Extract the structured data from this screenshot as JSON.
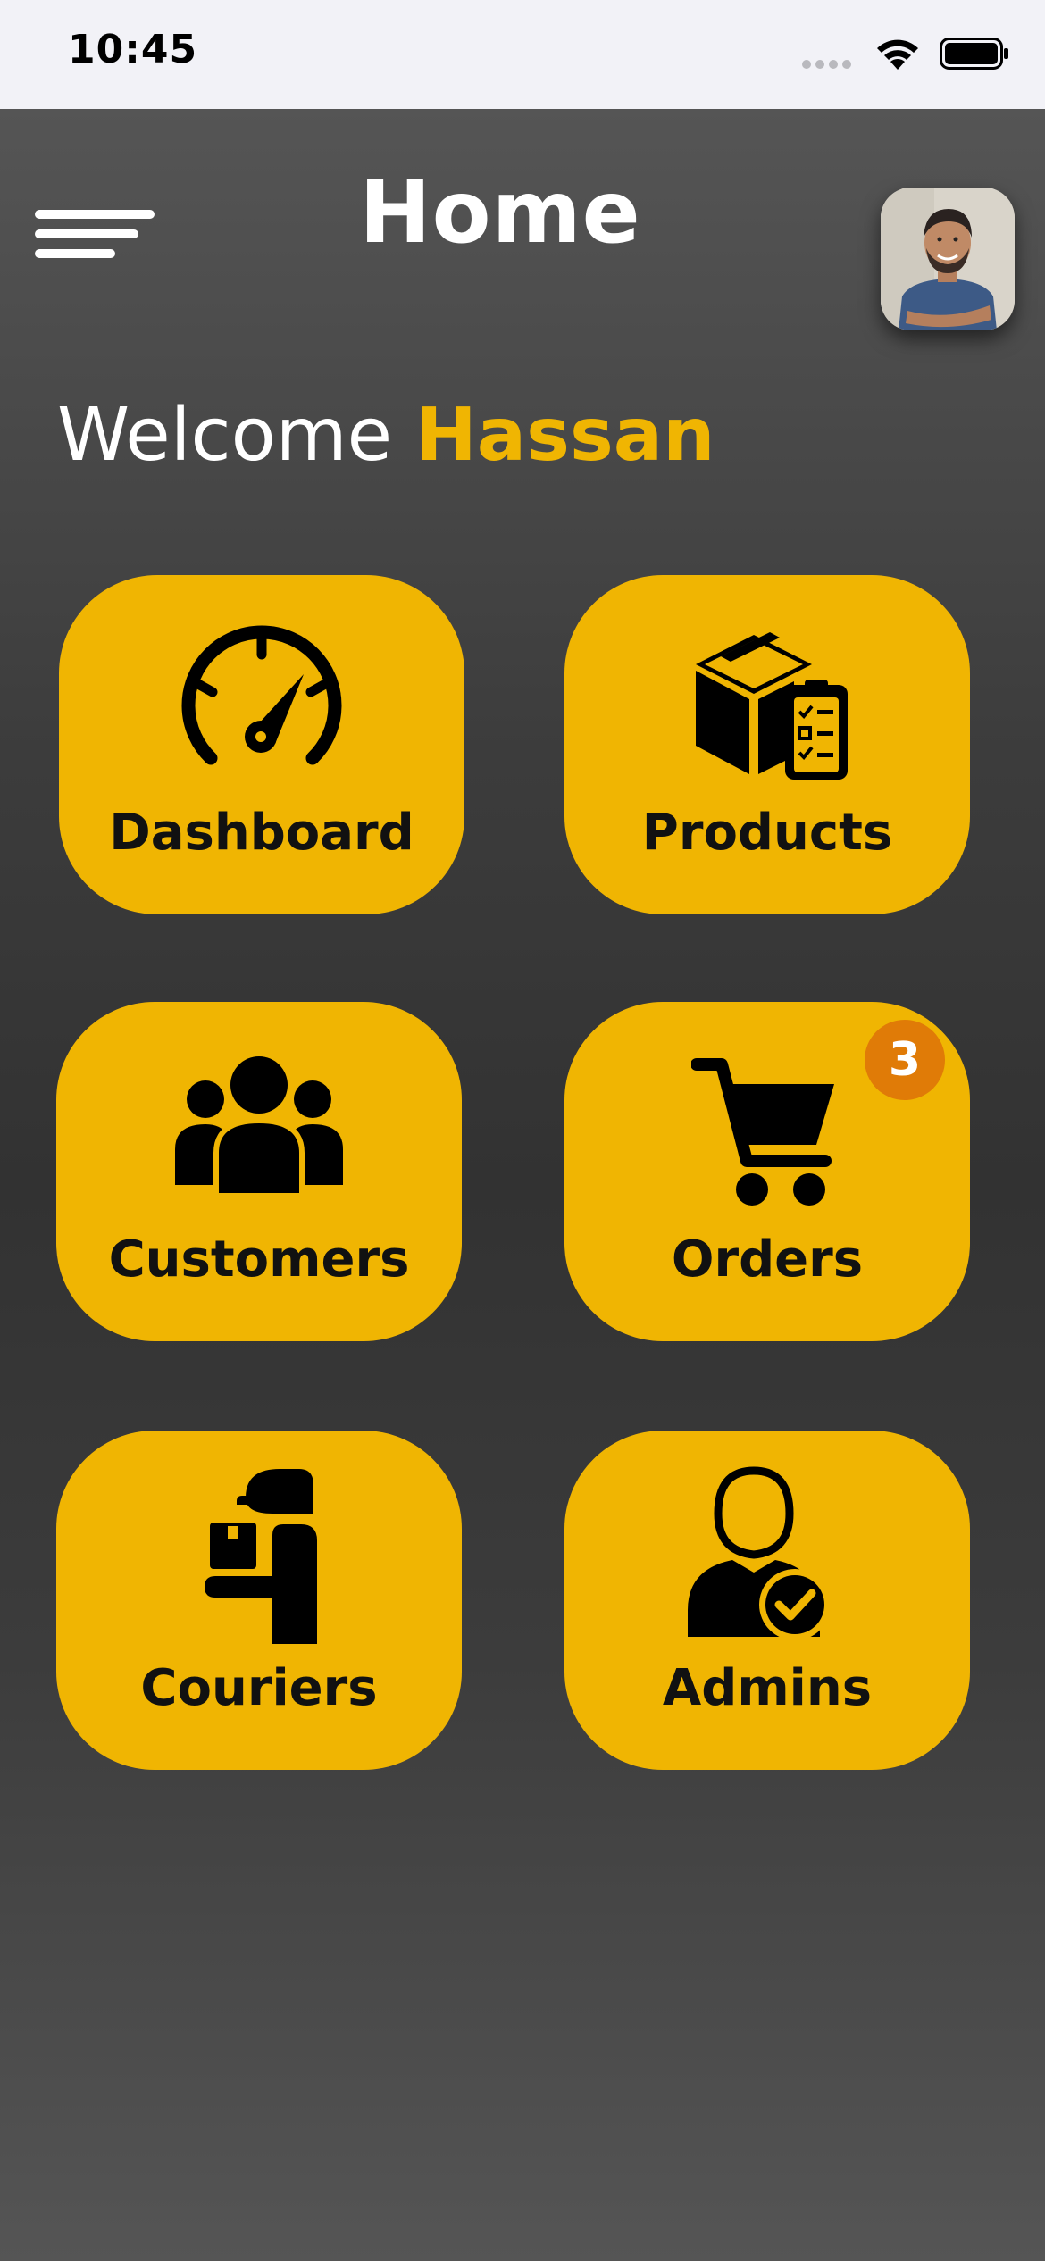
{
  "status_bar": {
    "time": "10:45",
    "icons": [
      "cellular-signal-icon",
      "wifi-icon",
      "battery-icon"
    ]
  },
  "header": {
    "title": "Home",
    "menu_icon": "hamburger-menu-icon",
    "avatar": "user-avatar"
  },
  "welcome": {
    "prefix": "Welcome",
    "name": "Hassan"
  },
  "tiles": [
    {
      "label": "Dashboard",
      "icon": "speedometer-icon"
    },
    {
      "label": "Products",
      "icon": "box-checklist-icon"
    },
    {
      "label": "Customers",
      "icon": "people-group-icon"
    },
    {
      "label": "Orders",
      "icon": "shopping-cart-icon",
      "badge": "3"
    },
    {
      "label": "Couriers",
      "icon": "delivery-person-icon"
    },
    {
      "label": "Admins",
      "icon": "admin-verified-icon"
    }
  ],
  "colors": {
    "accent": "#f0b502",
    "badge": "#e07b07",
    "background_dark": "#333333",
    "status_bar_bg": "#f2f2f7"
  }
}
